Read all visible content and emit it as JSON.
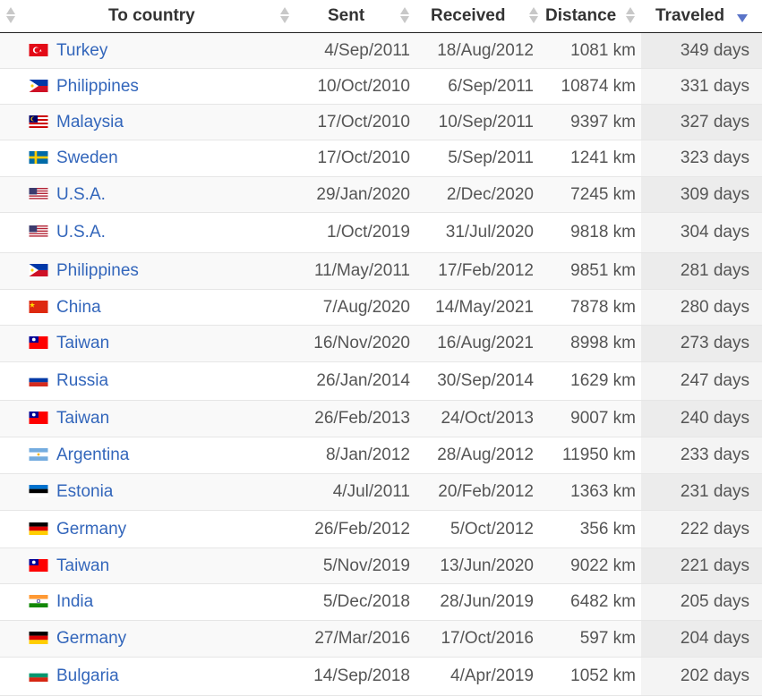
{
  "headers": [
    {
      "label": "To country",
      "key": "country"
    },
    {
      "label": "Sent",
      "key": "sent"
    },
    {
      "label": "Received",
      "key": "received"
    },
    {
      "label": "Distance",
      "key": "distance"
    },
    {
      "label": "Traveled",
      "key": "traveled"
    }
  ],
  "sort": {
    "column": "Traveled",
    "direction": "descending"
  },
  "rows": [
    {
      "country": "Turkey",
      "flag": "flag-turkey-icon",
      "sent": "4/Sep/2011",
      "received": "18/Aug/2012",
      "distance": "1081 km",
      "traveled": "349 days"
    },
    {
      "country": "Philippines",
      "flag": "flag-philippines-icon",
      "sent": "10/Oct/2010",
      "received": "6/Sep/2011",
      "distance": "10874 km",
      "traveled": "331 days"
    },
    {
      "country": "Malaysia",
      "flag": "flag-malaysia-icon",
      "sent": "17/Oct/2010",
      "received": "10/Sep/2011",
      "distance": "9397 km",
      "traveled": "327 days"
    },
    {
      "country": "Sweden",
      "flag": "flag-sweden-icon",
      "sent": "17/Oct/2010",
      "received": "5/Sep/2011",
      "distance": "1241 km",
      "traveled": "323 days"
    },
    {
      "country": "U.S.A.",
      "flag": "flag-usa-icon",
      "sent": "29/Jan/2020",
      "received": "2/Dec/2020",
      "distance": "7245 km",
      "traveled": "309 days"
    },
    {
      "country": "U.S.A.",
      "flag": "flag-usa-icon",
      "sent": "1/Oct/2019",
      "received": "31/Jul/2020",
      "distance": "9818 km",
      "traveled": "304 days"
    },
    {
      "country": "Philippines",
      "flag": "flag-philippines-icon",
      "sent": "11/May/2011",
      "received": "17/Feb/2012",
      "distance": "9851 km",
      "traveled": "281 days"
    },
    {
      "country": "China",
      "flag": "flag-china-icon",
      "sent": "7/Aug/2020",
      "received": "14/May/2021",
      "distance": "7878 km",
      "traveled": "280 days"
    },
    {
      "country": "Taiwan",
      "flag": "flag-taiwan-icon",
      "sent": "16/Nov/2020",
      "received": "16/Aug/2021",
      "distance": "8998 km",
      "traveled": "273 days"
    },
    {
      "country": "Russia",
      "flag": "flag-russia-icon",
      "sent": "26/Jan/2014",
      "received": "30/Sep/2014",
      "distance": "1629 km",
      "traveled": "247 days"
    },
    {
      "country": "Taiwan",
      "flag": "flag-taiwan-icon",
      "sent": "26/Feb/2013",
      "received": "24/Oct/2013",
      "distance": "9007 km",
      "traveled": "240 days"
    },
    {
      "country": "Argentina",
      "flag": "flag-argentina-icon",
      "sent": "8/Jan/2012",
      "received": "28/Aug/2012",
      "distance": "11950 km",
      "traveled": "233 days"
    },
    {
      "country": "Estonia",
      "flag": "flag-estonia-icon",
      "sent": "4/Jul/2011",
      "received": "20/Feb/2012",
      "distance": "1363 km",
      "traveled": "231 days"
    },
    {
      "country": "Germany",
      "flag": "flag-germany-icon",
      "sent": "26/Feb/2012",
      "received": "5/Oct/2012",
      "distance": "356 km",
      "traveled": "222 days"
    },
    {
      "country": "Taiwan",
      "flag": "flag-taiwan-icon",
      "sent": "5/Nov/2019",
      "received": "13/Jun/2020",
      "distance": "9022 km",
      "traveled": "221 days"
    },
    {
      "country": "India",
      "flag": "flag-india-icon",
      "sent": "5/Dec/2018",
      "received": "28/Jun/2019",
      "distance": "6482 km",
      "traveled": "205 days"
    },
    {
      "country": "Germany",
      "flag": "flag-germany-icon",
      "sent": "27/Mar/2016",
      "received": "17/Oct/2016",
      "distance": "597 km",
      "traveled": "204 days"
    },
    {
      "country": "Bulgaria",
      "flag": "flag-bulgaria-icon",
      "sent": "14/Sep/2018",
      "received": "4/Apr/2019",
      "distance": "1052 km",
      "traveled": "202 days"
    }
  ],
  "colors": {
    "link": "#3366bb",
    "sort_active": "#5a74c8",
    "sort_inactive": "#c8c8c8",
    "traveled_column_bg": "#ececec"
  }
}
